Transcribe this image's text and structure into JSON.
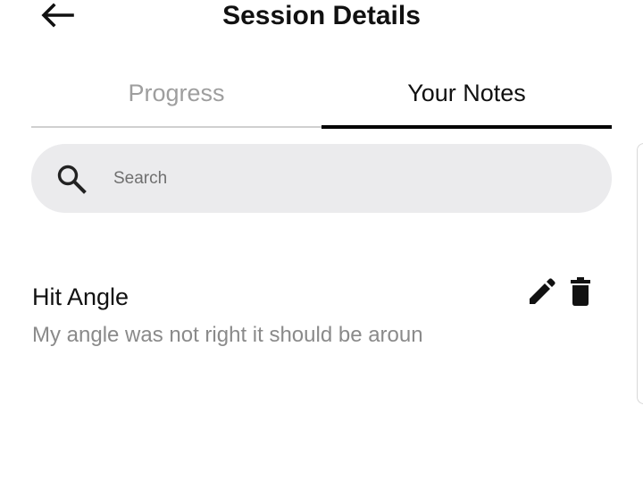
{
  "header": {
    "title": "Session Details",
    "back_icon": "arrow-left-icon"
  },
  "tabs": [
    {
      "label": "Progress",
      "active": false
    },
    {
      "label": "Your Notes",
      "active": true
    }
  ],
  "search": {
    "placeholder": "Search",
    "value": "",
    "icon": "search-icon"
  },
  "notes": [
    {
      "title": "Hit Angle",
      "preview": "My angle was not right it should be aroun",
      "edit_icon": "pencil-icon",
      "delete_icon": "trash-icon"
    }
  ],
  "colors": {
    "active_tab": "#000000",
    "inactive_tab_text": "#9e9e9e",
    "search_bg": "#ebebed",
    "preview_text": "#8a8a8a"
  }
}
